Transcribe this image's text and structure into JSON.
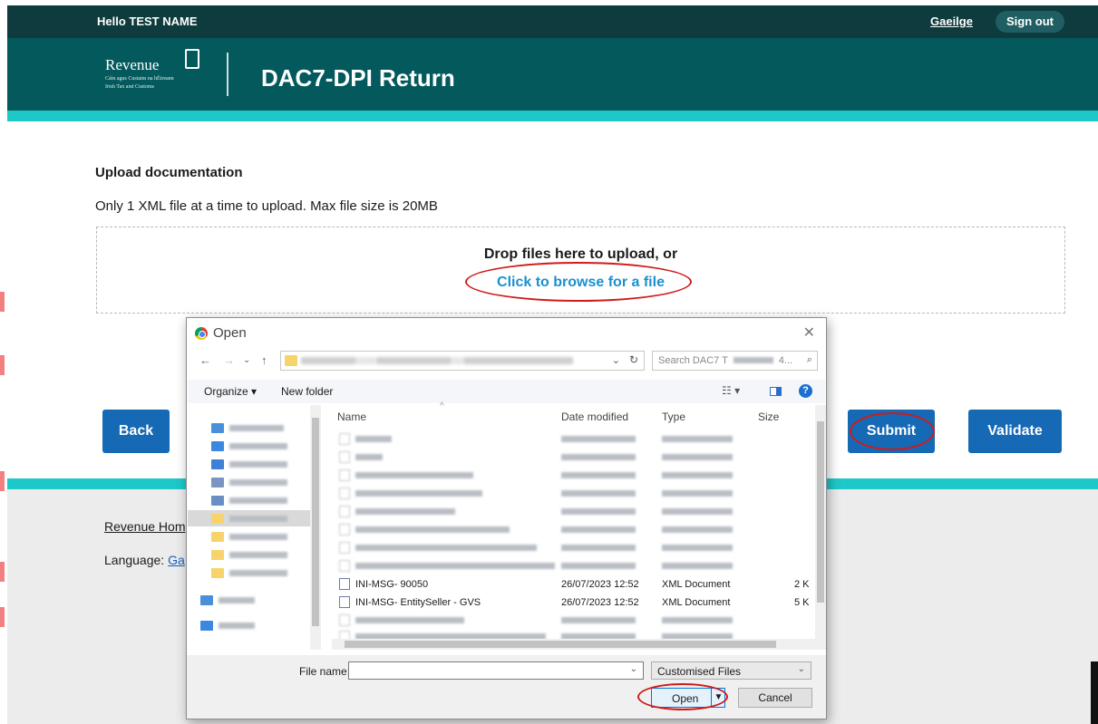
{
  "topbar": {
    "greeting": "Hello TEST NAME",
    "language_link": "Gaeilge",
    "sign_out": "Sign out"
  },
  "header": {
    "logo_word": "Revenue",
    "logo_sub1": "Cáin agus Custaim na hÉireann",
    "logo_sub2": "Irish Tax and Customs",
    "title": "DAC7-DPI Return"
  },
  "upload": {
    "heading": "Upload documentation",
    "info": "Only 1 XML file at a time to upload. Max file size is 20MB",
    "drop_text": "Drop files here to upload, or",
    "browse_link": "Click to browse for a file"
  },
  "actions": {
    "back": "Back",
    "submit": "Submit",
    "validate": "Validate"
  },
  "footer": {
    "home_link": "Revenue Hom",
    "language_label": "Language:",
    "language_link": "Ga"
  },
  "colors": {
    "topbar": "#0e3b3d",
    "header": "#03595c",
    "accent": "#1ec8c8",
    "button": "#1669b4",
    "link": "#1a90d0",
    "annotation": "#d01b1b"
  },
  "dialog": {
    "title": "Open",
    "search_placeholder": "Search DAC7 T",
    "search_suffix": "4...",
    "organize": "Organize ▾",
    "new_folder": "New folder",
    "columns": {
      "name": "Name",
      "date": "Date modified",
      "type": "Type",
      "size": "Size"
    },
    "visible_files": [
      {
        "name": "INI-MSG- 90050",
        "date": "26/07/2023 12:52",
        "type": "XML Document",
        "size": "2 K"
      },
      {
        "name": "INI-MSG- EntitySeller - GVS",
        "date": "26/07/2023 12:52",
        "type": "XML Document",
        "size": "5 K"
      }
    ],
    "file_name_label": "File name:",
    "file_name_value": "",
    "filter": "Customised Files",
    "open_button": "Open",
    "cancel_button": "Cancel"
  }
}
